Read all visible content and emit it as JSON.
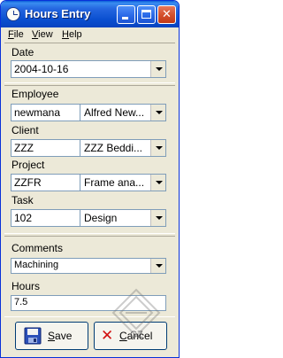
{
  "window": {
    "title": "Hours Entry"
  },
  "titlebar": {
    "min_icon": "minimize-icon",
    "max_icon": "maximize-icon",
    "close_icon": "close-icon",
    "close_glyph": "✕"
  },
  "menu": [
    {
      "label_u": "F",
      "label_rest": "ile"
    },
    {
      "label_u": "V",
      "label_rest": "iew"
    },
    {
      "label_u": "H",
      "label_rest": "elp"
    }
  ],
  "date": {
    "label": "Date",
    "value": "2004-10-16"
  },
  "employee": {
    "label": "Employee",
    "code": "newmana",
    "name": "Alfred New..."
  },
  "client": {
    "label": "Client",
    "code": "ZZZ",
    "name": "ZZZ Beddi..."
  },
  "project": {
    "label": "Project",
    "code": "ZZFR",
    "name": "Frame ana..."
  },
  "task": {
    "label": "Task",
    "code": "102",
    "name": "Design"
  },
  "comments": {
    "label": "Comments",
    "value": "Machining"
  },
  "hours": {
    "label": "Hours",
    "value": "7.5"
  },
  "buttons": {
    "save_u": "S",
    "save_rest": "ave",
    "cancel_u": "C",
    "cancel_rest": "ancel",
    "cancel_glyph": "✕"
  },
  "watermark": {
    "text": "CZ",
    "dot_text": ".CZ"
  },
  "colors": {
    "title_blue": "#0a4fd0",
    "face": "#ece9d8",
    "field_border": "#7f9db9",
    "cancel_red": "#d11010"
  }
}
